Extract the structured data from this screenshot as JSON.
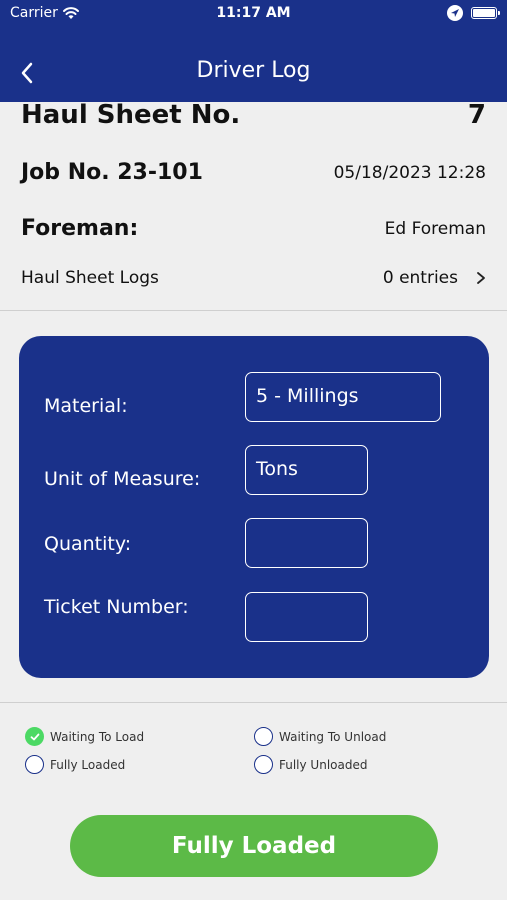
{
  "status_bar": {
    "carrier": "Carrier",
    "time": "11:17 AM"
  },
  "nav": {
    "title": "Driver Log",
    "back_icon": "chevron-left-icon"
  },
  "haul_sheet": {
    "label": "Haul Sheet No.",
    "value": "7"
  },
  "job": {
    "label": "Job No. 23-101",
    "datetime": "05/18/2023 12:28"
  },
  "foreman": {
    "label": "Foreman:",
    "value": "Ed Foreman"
  },
  "logs": {
    "label": "Haul Sheet Logs",
    "count": "0 entries",
    "icon": "chevron-right-icon"
  },
  "form": {
    "material": {
      "label": "Material:",
      "value": "5 - Millings"
    },
    "unit": {
      "label": "Unit of Measure:",
      "value": "Tons"
    },
    "quantity": {
      "label": "Quantity:",
      "value": ""
    },
    "ticket": {
      "label": "Ticket Number:",
      "value": ""
    }
  },
  "statuses": [
    {
      "label": "Waiting To Load",
      "checked": true
    },
    {
      "label": "Waiting To Unload",
      "checked": false
    },
    {
      "label": "Fully Loaded",
      "checked": false
    },
    {
      "label": "Fully Unloaded",
      "checked": false
    }
  ],
  "action_button": {
    "label": "Fully Loaded"
  },
  "colors": {
    "brand": "#1a318a",
    "accent": "#5cba47",
    "check": "#4cd964"
  }
}
